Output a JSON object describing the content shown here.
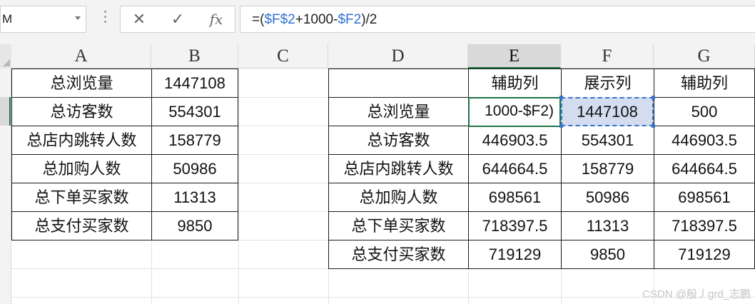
{
  "name_box": "M",
  "formula": {
    "p1": "=(",
    "r1": "$F$2",
    "p2": "+1000-",
    "r2": "$F2",
    "p3": ")/2",
    "fx_label": "fx",
    "cancel_glyph": "✕",
    "enter_glyph": "✓"
  },
  "columns": [
    "A",
    "B",
    "C",
    "D",
    "E",
    "F",
    "G"
  ],
  "left_table": {
    "rows": [
      [
        "总浏览量",
        "1447108"
      ],
      [
        "总访客数",
        "554301"
      ],
      [
        "总店内跳转人数",
        "158779"
      ],
      [
        "总加购人数",
        "50986"
      ],
      [
        "总下单买家数",
        "11313"
      ],
      [
        "总支付买家数",
        "9850"
      ]
    ]
  },
  "right_table": {
    "header": [
      "",
      "辅助列",
      "展示列",
      "辅助列"
    ],
    "rows": [
      [
        "总浏览量",
        "1000-$F2)",
        "1447108",
        "500"
      ],
      [
        "总访客数",
        "446903.5",
        "554301",
        "446903.5"
      ],
      [
        "总店内跳转人数",
        "644664.5",
        "158779",
        "644664.5"
      ],
      [
        "总加购人数",
        "698561",
        "50986",
        "698561"
      ],
      [
        "总下单买家数",
        "718397.5",
        "11313",
        "718397.5"
      ],
      [
        "总支付买家数",
        "719129",
        "9850",
        "719129"
      ]
    ]
  },
  "watermark": "CSDN @殷丿grd_志鹏",
  "colors": {
    "accent": "#217346",
    "reference": "#2f6fd1",
    "ref_fill": "#d3ddef"
  }
}
